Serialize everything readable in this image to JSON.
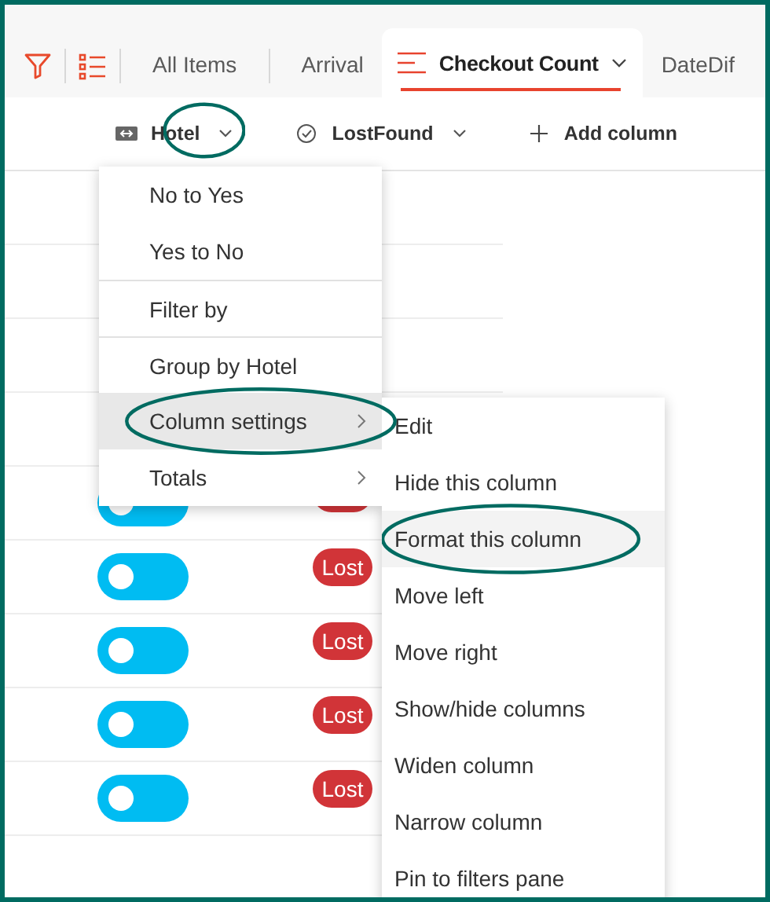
{
  "tabs": [
    {
      "label": "All Items",
      "selected": false
    },
    {
      "label": "Arrival",
      "selected": false
    },
    {
      "label": "Checkout Count",
      "selected": true
    },
    {
      "label": "DateDif",
      "selected": false
    }
  ],
  "columns": [
    {
      "kind": "hotel",
      "label": "Hotel",
      "circled": true
    },
    {
      "kind": "lostfound",
      "label": "LostFound",
      "circled": false
    },
    {
      "kind": "add",
      "label": "Add column",
      "circled": false
    }
  ],
  "rows": [
    {
      "kind": "covered"
    },
    {
      "kind": "covered"
    },
    {
      "kind": "covered"
    },
    {
      "kind": "covered"
    },
    {
      "kind": "lost",
      "color": "#00bcf2"
    },
    {
      "kind": "lost",
      "color": "#00bcf2",
      "badge": "Lost"
    },
    {
      "kind": "lost",
      "color": "#00bcf2",
      "badge": "Lost"
    },
    {
      "kind": "lost",
      "color": "#00bcf2",
      "badge": "Lost"
    },
    {
      "kind": "lost",
      "color": "#00bcf2",
      "badge": "Lost"
    }
  ],
  "menu": [
    {
      "label": "No to Yes",
      "separator_above": false,
      "highlighted": false,
      "circled": false
    },
    {
      "label": "Yes to No",
      "separator_above": false,
      "highlighted": false,
      "circled": false
    },
    {
      "label": "Filter by",
      "separator_above": true,
      "highlighted": false,
      "circled": false
    },
    {
      "label": "Group by Hotel",
      "separator_above": true,
      "highlighted": false,
      "circled": false
    },
    {
      "label": "Column settings",
      "separator_above": false,
      "highlighted": true,
      "circled": true,
      "has_submenu": true,
      "children": [
        {
          "label": "Edit",
          "highlighted": false,
          "circled": false
        },
        {
          "label": "Hide this column",
          "highlighted": false,
          "circled": false
        },
        {
          "label": "Format this column",
          "highlighted": true,
          "circled": true
        },
        {
          "label": "Move left",
          "highlighted": false,
          "circled": false
        },
        {
          "label": "Move right",
          "highlighted": false,
          "circled": false
        },
        {
          "label": "Show/hide columns",
          "highlighted": false,
          "circled": false
        },
        {
          "label": "Widen column",
          "highlighted": false,
          "circled": false
        },
        {
          "label": "Narrow column",
          "highlighted": false,
          "circled": false
        },
        {
          "label": "Pin to filters pane",
          "highlighted": false,
          "circled": false
        }
      ]
    },
    {
      "label": "Totals",
      "separator_above": false,
      "highlighted": false,
      "circled": false,
      "has_submenu": true
    }
  ]
}
